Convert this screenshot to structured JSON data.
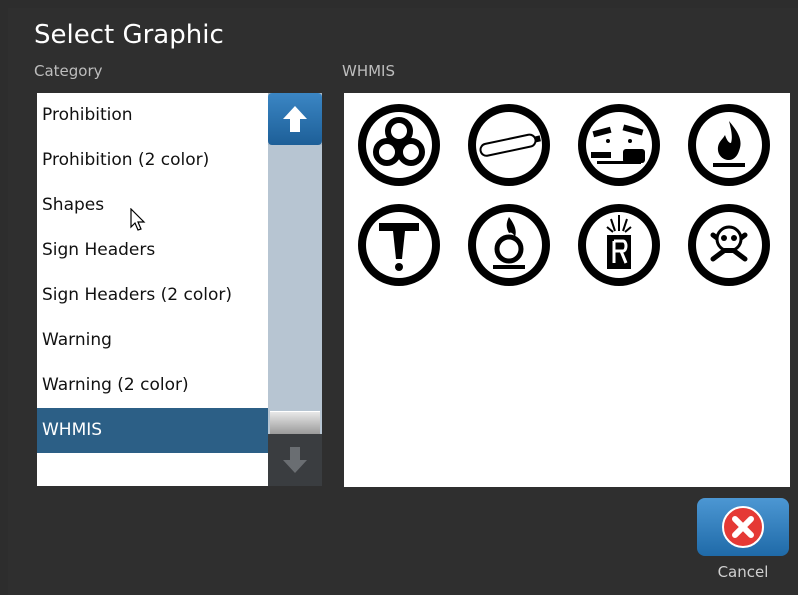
{
  "dialog": {
    "title": "Select Graphic",
    "category_label": "Category",
    "graphics_label": "WHMIS"
  },
  "categories": [
    {
      "label": "Prohibition"
    },
    {
      "label": "Prohibition (2 color)"
    },
    {
      "label": "Shapes"
    },
    {
      "label": "Sign Headers"
    },
    {
      "label": "Sign Headers (2 color)"
    },
    {
      "label": "Warning"
    },
    {
      "label": "Warning (2 color)"
    },
    {
      "label": "WHMIS",
      "selected": true
    }
  ],
  "graphics": [
    {
      "icon": "biohazard-icon"
    },
    {
      "icon": "compressed-gas-icon"
    },
    {
      "icon": "corrosive-icon"
    },
    {
      "icon": "flammable-icon"
    },
    {
      "icon": "toxic-other-effects-icon"
    },
    {
      "icon": "oxidizing-icon"
    },
    {
      "icon": "dangerously-reactive-icon"
    },
    {
      "icon": "poison-skull-icon"
    }
  ],
  "buttons": {
    "cancel_label": "Cancel"
  },
  "colors": {
    "selected": "#2c5f86",
    "accent": "#1f6aa8",
    "cancel_x": "#e53935"
  }
}
